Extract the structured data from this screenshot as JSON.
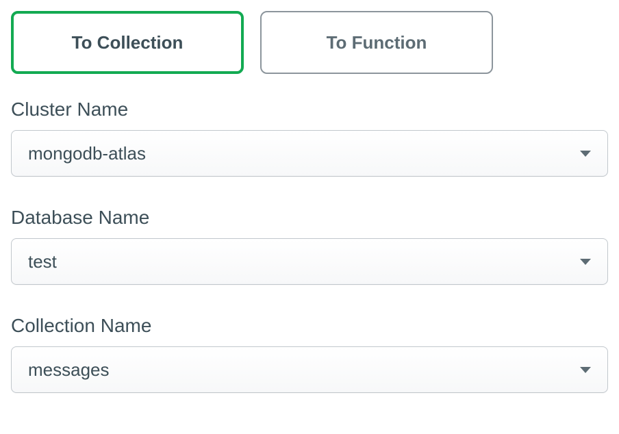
{
  "tabs": {
    "to_collection": "To Collection",
    "to_function": "To Function"
  },
  "fields": {
    "cluster": {
      "label": "Cluster Name",
      "value": "mongodb-atlas"
    },
    "database": {
      "label": "Database Name",
      "value": "test"
    },
    "collection": {
      "label": "Collection Name",
      "value": "messages"
    }
  }
}
